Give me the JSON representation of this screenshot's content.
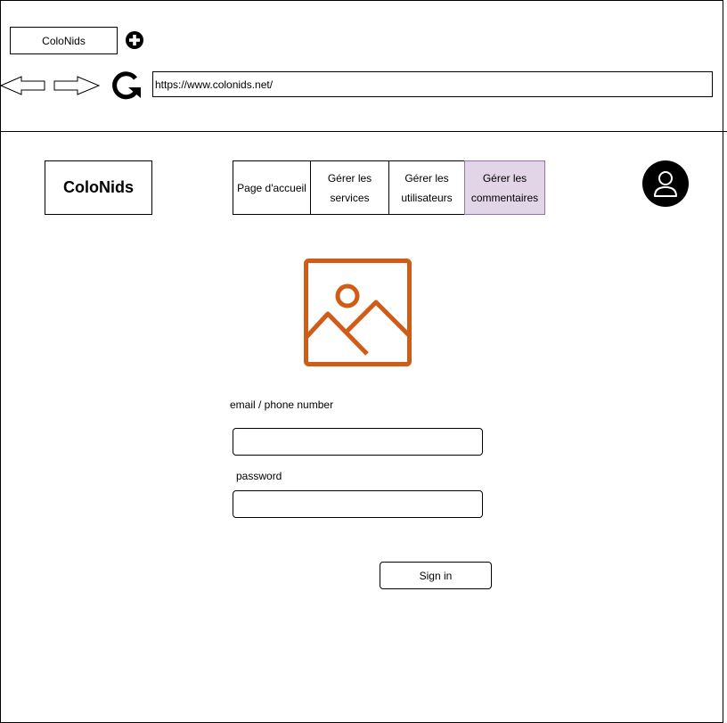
{
  "browser": {
    "tab_title": "ColoNids",
    "url": "https://www.colonids.net/",
    "icons": {
      "new_tab": "plus-circle-icon",
      "back": "arrow-left-icon",
      "forward": "arrow-right-icon",
      "reload": "reload-icon"
    }
  },
  "header": {
    "logo_text": "ColoNids",
    "nav": [
      {
        "label": "Page d'accueil"
      },
      {
        "label": "Gérer les services"
      },
      {
        "label": "Gérer les utilisateurs"
      },
      {
        "label": "Gérer les commentaires"
      }
    ],
    "active_nav": "Gérer les commentaires",
    "user_icon": "user-icon"
  },
  "main": {
    "image_icon": "image-placeholder-icon",
    "email_label": "email / phone number",
    "email_value": "",
    "password_label": "password",
    "password_value": "",
    "signin_label": "Sign in"
  },
  "colors": {
    "active_nav_bg": "#e1d5e7",
    "active_nav_border": "#9673a6",
    "image_icon": "#d05c17"
  }
}
